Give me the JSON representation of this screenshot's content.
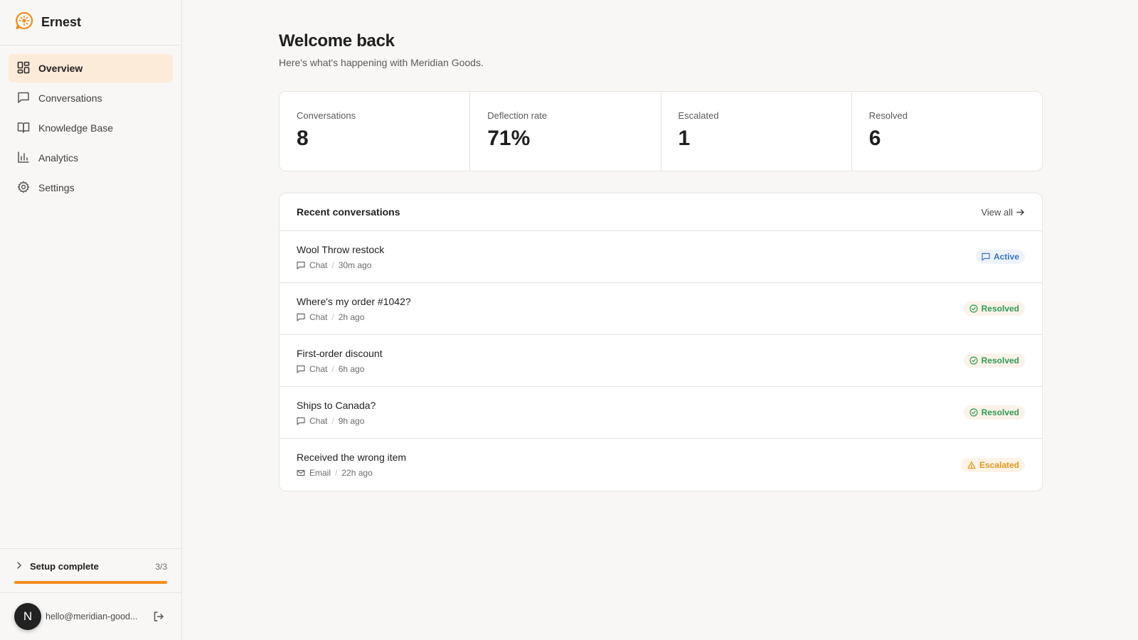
{
  "app": {
    "name": "Ernest",
    "brand_color": "#f28c1e"
  },
  "nav": [
    {
      "label": "Overview",
      "icon": "grid-icon",
      "active": true
    },
    {
      "label": "Conversations",
      "icon": "message-square-icon",
      "active": false
    },
    {
      "label": "Knowledge Base",
      "icon": "book-icon",
      "active": false
    },
    {
      "label": "Analytics",
      "icon": "bar-chart-icon",
      "active": false
    },
    {
      "label": "Settings",
      "icon": "gear-icon",
      "active": false
    }
  ],
  "setup": {
    "title": "Setup complete",
    "count": "3/3",
    "progress": 1.0
  },
  "user": {
    "initial": "N",
    "email": "hello@meridian-good..."
  },
  "header": {
    "title": "Welcome back",
    "subtitle": "Here's what's happening with Meridian Goods."
  },
  "stats": [
    {
      "label": "Conversations",
      "value": "8"
    },
    {
      "label": "Deflection rate",
      "value": "71%"
    },
    {
      "label": "Escalated",
      "value": "1"
    },
    {
      "label": "Resolved",
      "value": "6"
    }
  ],
  "recent": {
    "title": "Recent conversations",
    "view_all": "View all",
    "rows": [
      {
        "title": "Wool Throw restock",
        "channel": "Chat",
        "channel_icon": "message-square-icon",
        "time": "30m ago",
        "status": "Active",
        "status_kind": "active"
      },
      {
        "title": "Where's my order #1042?",
        "channel": "Chat",
        "channel_icon": "message-square-icon",
        "time": "2h ago",
        "status": "Resolved",
        "status_kind": "resolved"
      },
      {
        "title": "First-order discount",
        "channel": "Chat",
        "channel_icon": "message-square-icon",
        "time": "6h ago",
        "status": "Resolved",
        "status_kind": "resolved"
      },
      {
        "title": "Ships to Canada?",
        "channel": "Chat",
        "channel_icon": "message-square-icon",
        "time": "9h ago",
        "status": "Resolved",
        "status_kind": "resolved"
      },
      {
        "title": "Received the wrong item",
        "channel": "Email",
        "channel_icon": "mail-icon",
        "time": "22h ago",
        "status": "Escalated",
        "status_kind": "escalated"
      }
    ]
  }
}
